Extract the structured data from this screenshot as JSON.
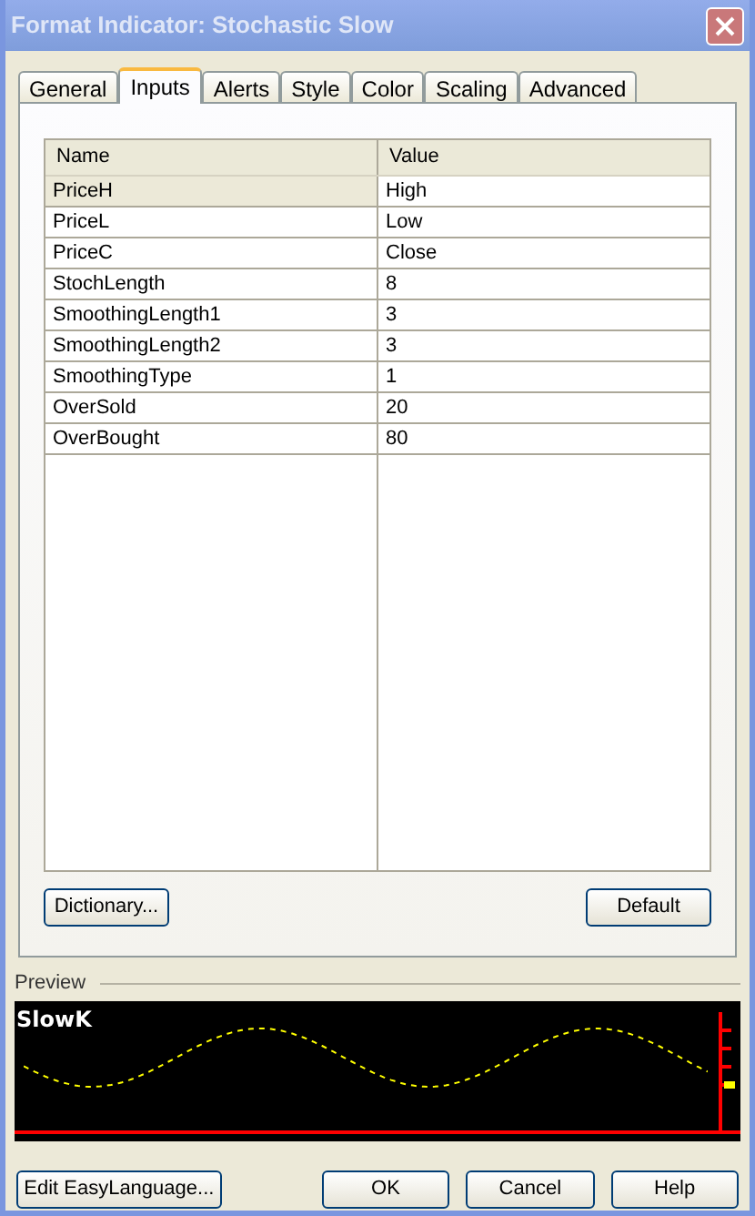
{
  "window": {
    "title": "Format Indicator: Stochastic Slow"
  },
  "tabs": [
    {
      "label": "General",
      "selected": false
    },
    {
      "label": "Inputs",
      "selected": true
    },
    {
      "label": "Alerts",
      "selected": false
    },
    {
      "label": "Style",
      "selected": false
    },
    {
      "label": "Color",
      "selected": false
    },
    {
      "label": "Scaling",
      "selected": false
    },
    {
      "label": "Advanced",
      "selected": false
    }
  ],
  "table": {
    "columns": [
      "Name",
      "Value"
    ],
    "rows": [
      {
        "name": "PriceH",
        "value": "High",
        "selected": true
      },
      {
        "name": "PriceL",
        "value": "Low",
        "selected": false
      },
      {
        "name": "PriceC",
        "value": "Close",
        "selected": false
      },
      {
        "name": "StochLength",
        "value": "8",
        "selected": false
      },
      {
        "name": "SmoothingLength1",
        "value": "3",
        "selected": false
      },
      {
        "name": "SmoothingLength2",
        "value": "3",
        "selected": false
      },
      {
        "name": "SmoothingType",
        "value": "1",
        "selected": false
      },
      {
        "name": "OverSold",
        "value": "20",
        "selected": false
      },
      {
        "name": "OverBought",
        "value": "80",
        "selected": false
      }
    ]
  },
  "panel_buttons": [
    "Dictionary...",
    "Default"
  ],
  "preview": {
    "label": "Preview",
    "plot_label": "SlowK"
  },
  "footer_buttons": [
    "Edit EasyLanguage...",
    "OK",
    "Cancel",
    "Help"
  ]
}
